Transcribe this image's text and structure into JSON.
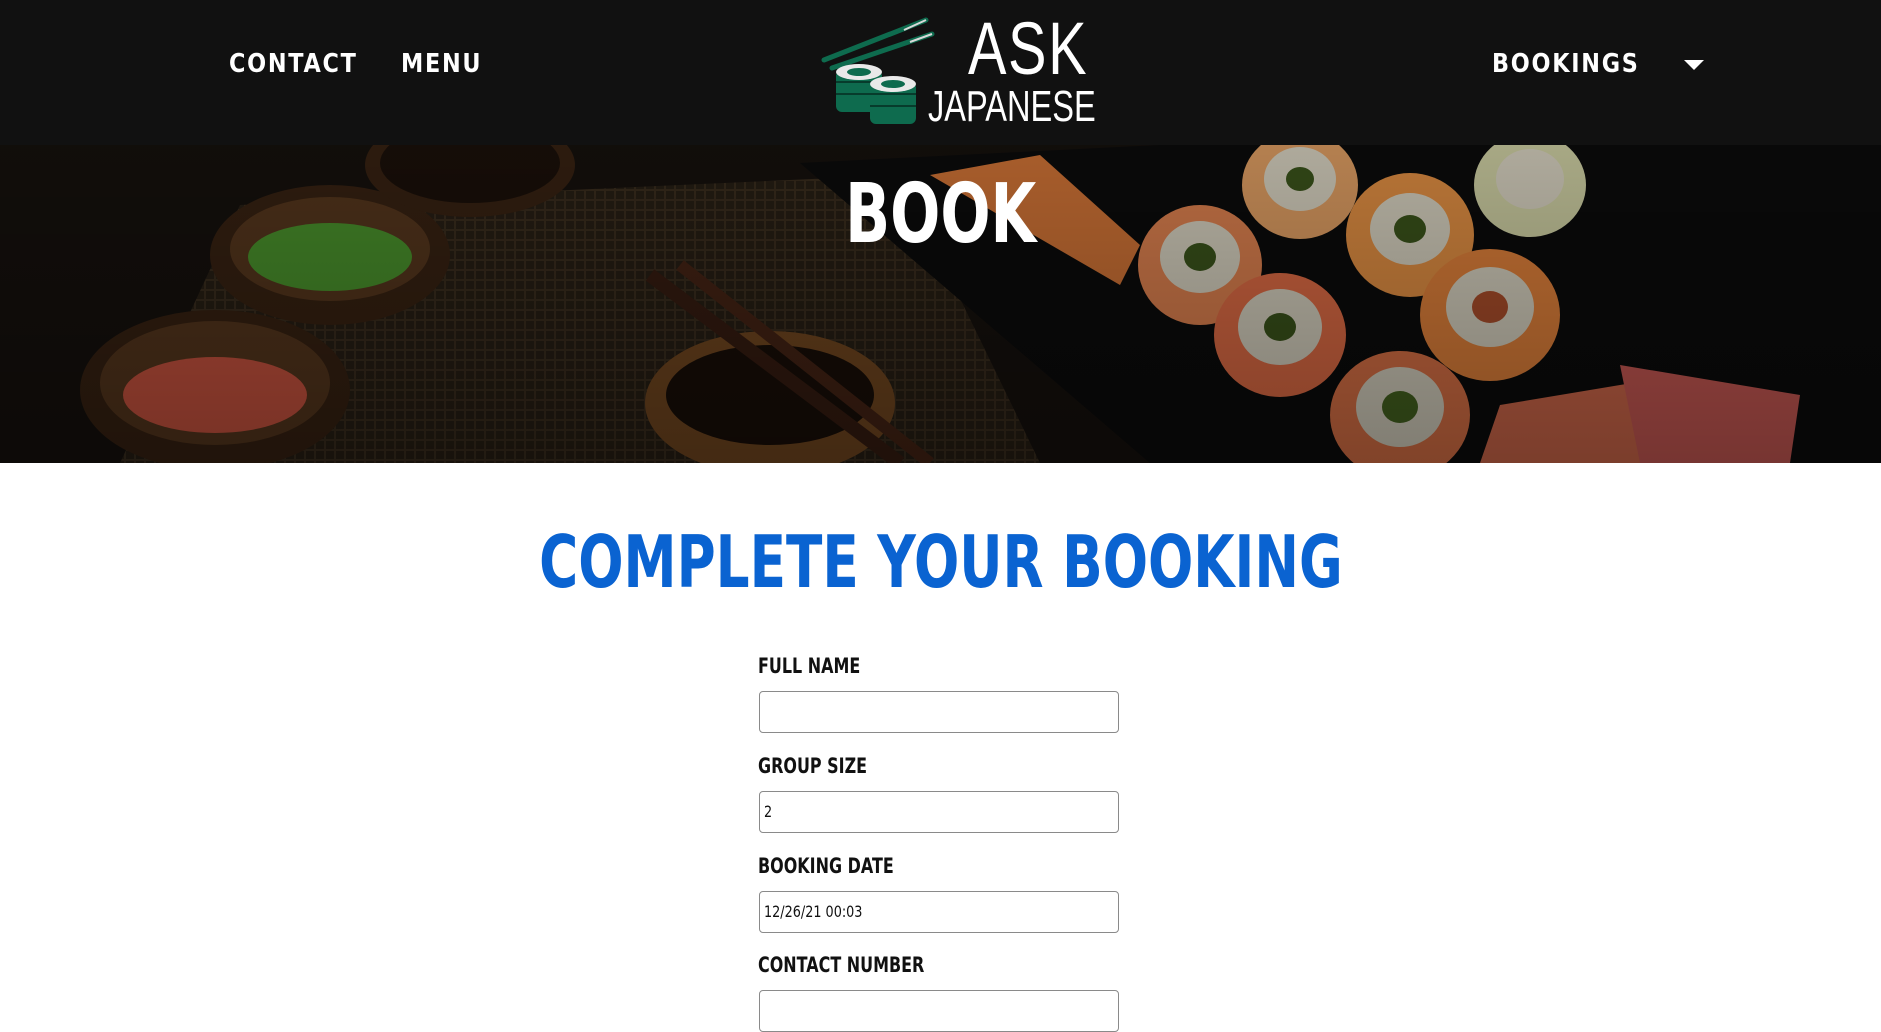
{
  "navbar": {
    "links": [
      "CONTACT",
      "MENU"
    ],
    "bookings_label": "BOOKINGS"
  },
  "logo": {
    "line1": "ASK",
    "line2": "JAPANESE"
  },
  "hero": {
    "title": "BOOK"
  },
  "booking_form": {
    "title": "COMPLETE YOUR BOOKING",
    "full_name_label": "FULL NAME",
    "full_name_value": "",
    "group_size_label": "GROUP SIZE",
    "group_size_value": "2",
    "booking_date_label": "BOOKING DATE",
    "booking_date_value": "12/26/21 00:03",
    "contact_number_label": "CONTACT NUMBER",
    "contact_number_value": ""
  },
  "colors": {
    "navbar_bg": "#111111",
    "accent_blue": "#0a63d1",
    "logo_green": "#0e6b4e"
  },
  "icons": [
    "chopsticks-icon",
    "sushi-roll-icon",
    "caret-down-icon"
  ]
}
